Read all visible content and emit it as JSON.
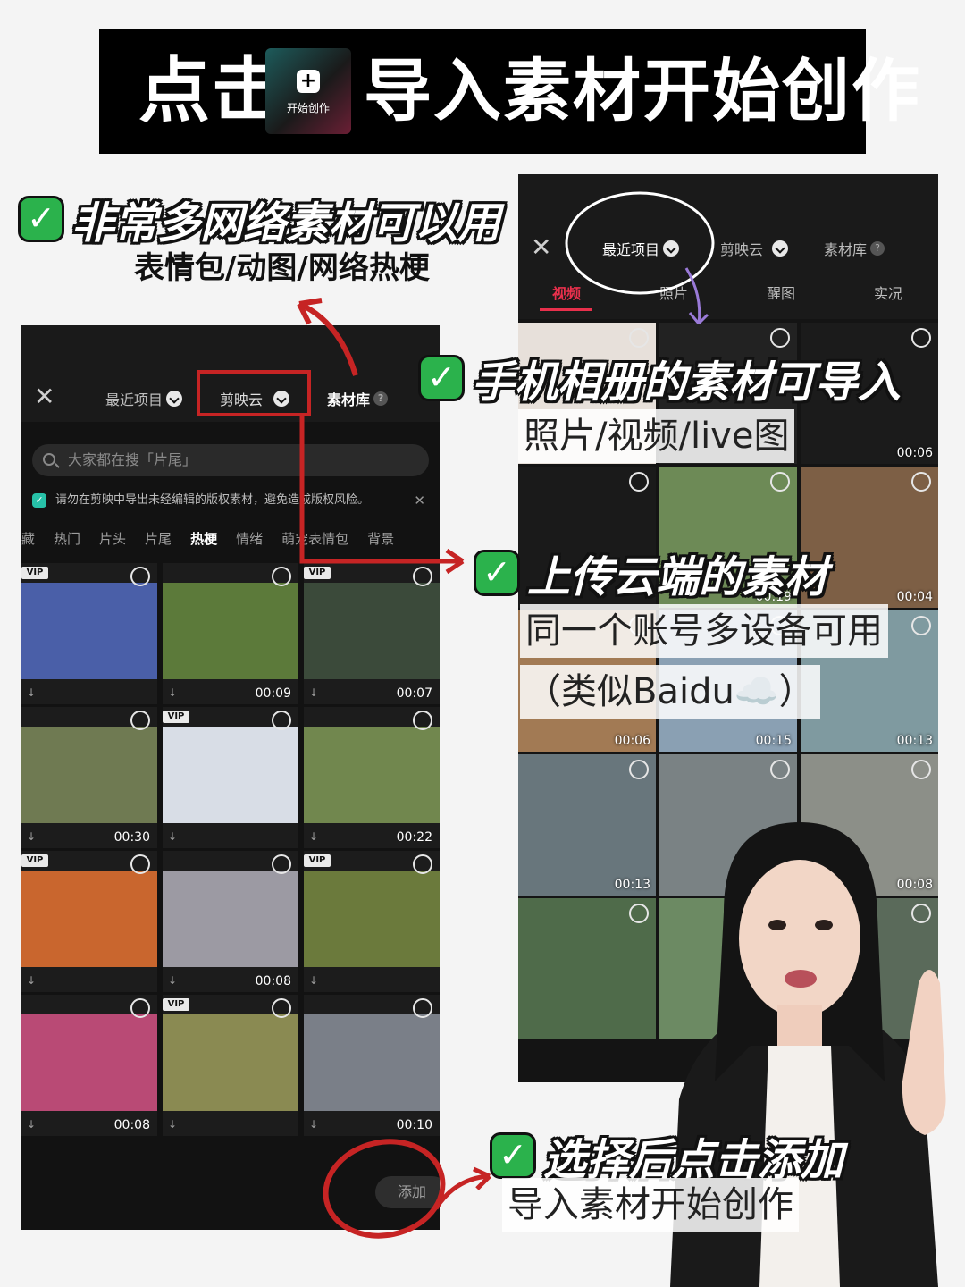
{
  "banner": {
    "click": "点击",
    "tile_plus": "+",
    "tile_label": "开始创作",
    "rest": "导入素材开始创作"
  },
  "captions": {
    "network": {
      "title": "非常多网络素材可以用",
      "sub": "表情包/动图/网络热梗"
    },
    "album": {
      "title": "手机相册的素材可导入",
      "sub": "照片/视频/live图"
    },
    "cloud": {
      "title": "上传云端的素材",
      "sub1": "同一个账号多设备可用",
      "sub2": "（类似Baidu☁️）"
    },
    "add": {
      "title": "选择后点击添加",
      "sub": "导入素材开始创作"
    },
    "check": "✓"
  },
  "left_phone": {
    "close": "✕",
    "tabs": {
      "recent": "最近项目",
      "cloud": "剪映云",
      "library": "素材库"
    },
    "help": "?",
    "search_placeholder": "大家都在搜「片尾」",
    "notice": "请勿在剪映中导出未经编辑的版权素材，避免造成版权风险。",
    "notice_close": "✕",
    "categories": [
      "藏",
      "热门",
      "片头",
      "片尾",
      "热梗",
      "情绪",
      "萌宠表情包",
      "背景"
    ],
    "active_category": "热梗",
    "grid": [
      {
        "vip": true,
        "duration": "",
        "color": "#4a5fa8"
      },
      {
        "vip": false,
        "duration": "00:09",
        "color": "#5c7a3a"
      },
      {
        "vip": true,
        "duration": "00:07",
        "color": "#3b4a3a"
      },
      {
        "vip": false,
        "duration": "00:30",
        "color": "#6f7a52"
      },
      {
        "vip": true,
        "duration": "",
        "color": "#d8dde6"
      },
      {
        "vip": false,
        "duration": "00:22",
        "color": "#71874e"
      },
      {
        "vip": true,
        "duration": "",
        "color": "#c9662e"
      },
      {
        "vip": false,
        "duration": "00:08",
        "color": "#9c9aa3"
      },
      {
        "vip": true,
        "duration": "",
        "color": "#6b7a3c"
      },
      {
        "vip": false,
        "duration": "00:08",
        "color": "#b94a75"
      },
      {
        "vip": true,
        "duration": "",
        "color": "#8a8a52"
      },
      {
        "vip": false,
        "duration": "00:10",
        "color": "#7a7f88"
      }
    ],
    "vip_label": "VIP",
    "download_icon": "↓",
    "add_button": "添加"
  },
  "right_phone": {
    "close": "✕",
    "tabs": {
      "recent": "最近项目",
      "cloud": "剪映云",
      "library": "素材库"
    },
    "help": "?",
    "media_tabs": [
      "视频",
      "照片",
      "醒图",
      "实况"
    ],
    "active_media_tab": "视频",
    "grid": [
      {
        "duration": "",
        "color": "#e7e0da"
      },
      {
        "duration": "",
        "color": "#222222"
      },
      {
        "duration": "00:06",
        "color": "#1b1b1b"
      },
      {
        "duration": "",
        "color": "#1a1a1a"
      },
      {
        "duration": "00:19",
        "color": "#6d8a56"
      },
      {
        "duration": "00:04",
        "color": "#7d5f45"
      },
      {
        "duration": "00:06",
        "color": "#a27a54"
      },
      {
        "duration": "00:15",
        "color": "#8aa0b3"
      },
      {
        "duration": "00:13",
        "color": "#7f9aa0"
      },
      {
        "duration": "00:13",
        "color": "#68767c"
      },
      {
        "duration": "",
        "color": "#7a8284"
      },
      {
        "duration": "00:08",
        "color": "#8c8f88"
      },
      {
        "duration": "",
        "color": "#4f6b4a"
      },
      {
        "duration": "",
        "color": "#6c8a63"
      },
      {
        "duration": "",
        "color": "#5a6a5a"
      }
    ]
  },
  "colors": {
    "accent_red": "#e8304c",
    "check_green": "#2bb24c",
    "annotation_red": "#c62424",
    "annotation_purple": "#9a7ad8"
  }
}
